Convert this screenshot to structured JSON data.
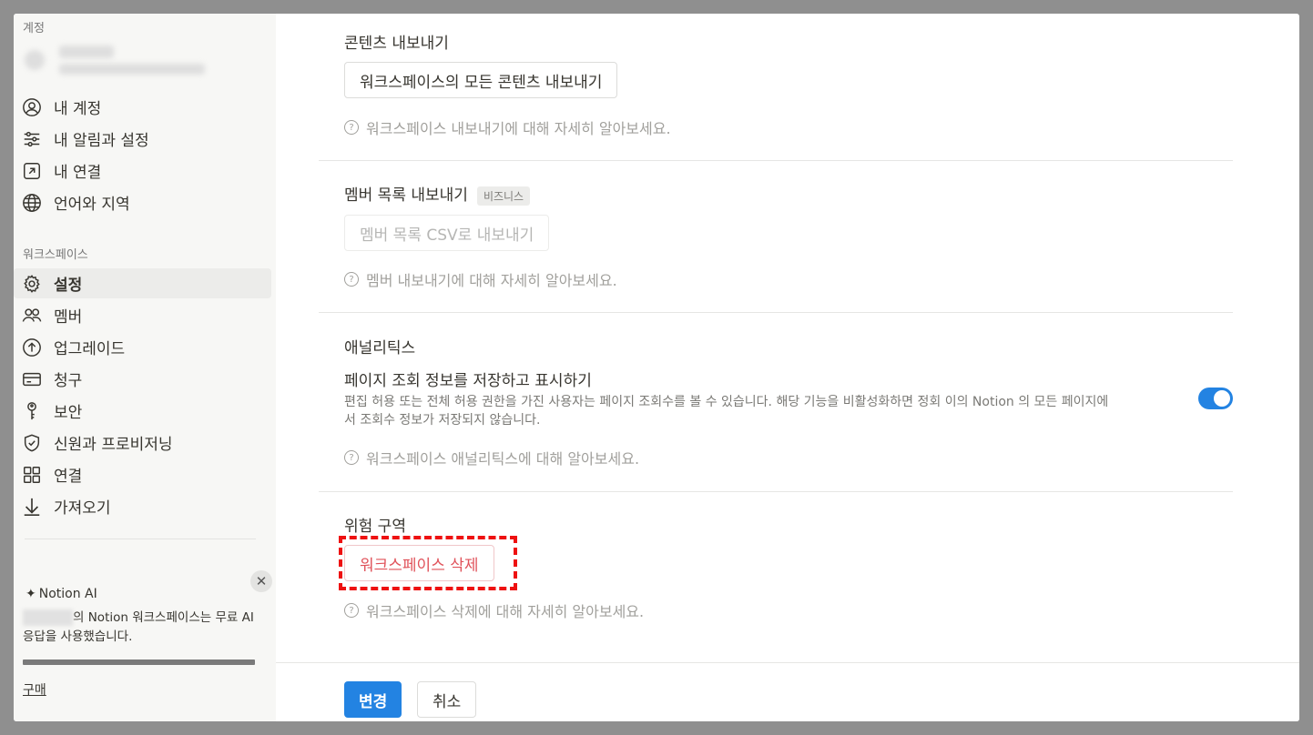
{
  "sidebar": {
    "account_title": "계정",
    "account_items": [
      {
        "label": "내 계정",
        "icon": "user-circle-icon"
      },
      {
        "label": "내 알림과 설정",
        "icon": "sliders-icon"
      },
      {
        "label": "내 연결",
        "icon": "external-link-icon"
      },
      {
        "label": "언어와 지역",
        "icon": "globe-icon"
      }
    ],
    "workspace_title": "워크스페이스",
    "workspace_items": [
      {
        "label": "설정",
        "icon": "gear-icon",
        "active": true
      },
      {
        "label": "멤버",
        "icon": "people-icon"
      },
      {
        "label": "업그레이드",
        "icon": "upgrade-icon"
      },
      {
        "label": "청구",
        "icon": "credit-card-icon"
      },
      {
        "label": "보안",
        "icon": "key-icon"
      },
      {
        "label": "신원과 프로비저닝",
        "icon": "shield-icon"
      },
      {
        "label": "연결",
        "icon": "grid-icon"
      },
      {
        "label": "가져오기",
        "icon": "download-icon"
      }
    ],
    "ai": {
      "title": "Notion AI",
      "text": "의 Notion 워크스페이스는 무료 AI 응답을 사용했습니다.",
      "buy": "구매"
    }
  },
  "content": {
    "export": {
      "title": "콘텐츠 내보내기",
      "button": "워크스페이스의 모든 콘텐츠 내보내기",
      "help": "워크스페이스 내보내기에 대해 자세히 알아보세요."
    },
    "members": {
      "title": "멤버 목록 내보내기",
      "badge": "비즈니스",
      "button": "멤버 목록 CSV로 내보내기",
      "help": "멤버 내보내기에 대해 자세히 알아보세요."
    },
    "analytics": {
      "title": "애널리틱스",
      "setting_title": "페이지 조회 정보를 저장하고 표시하기",
      "desc": "편집 허용 또는 전체 허용 권한을 가진 사용자는 페이지 조회수를 볼 수 있습니다. 해당 기능을 비활성화하면 정회 이의 Notion 의 모든 페이지에서 조회수 정보가 저장되지 않습니다.",
      "toggle_on": true,
      "help": "워크스페이스 애널리틱스에 대해 알아보세요."
    },
    "danger": {
      "title": "위험 구역",
      "button": "워크스페이스 삭제",
      "help": "워크스페이스 삭제에 대해 자세히 알아보세요."
    }
  },
  "footer": {
    "save": "변경",
    "cancel": "취소"
  },
  "colors": {
    "accent": "#2383e2",
    "danger": "#e0525a",
    "highlight": "#e11111"
  }
}
